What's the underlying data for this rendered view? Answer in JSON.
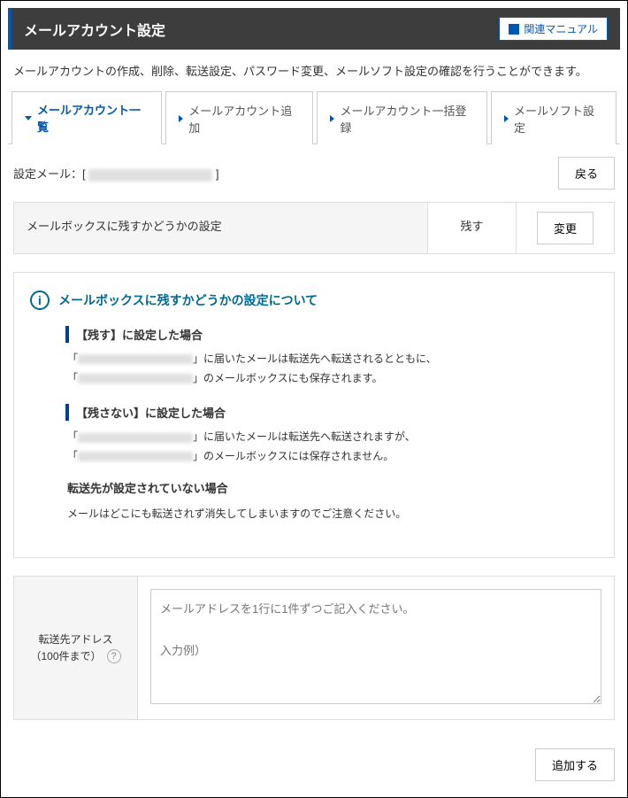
{
  "header": {
    "title": "メールアカウント設定",
    "manual_button": "関連マニュアル"
  },
  "description": "メールアカウントの作成、削除、転送設定、パスワード変更、メールソフト設定の確認を行うことができます。",
  "tabs": [
    {
      "label": "メールアカウント一覧",
      "active": true
    },
    {
      "label": "メールアカウント追加",
      "active": false
    },
    {
      "label": "メールアカウント一括登録",
      "active": false
    },
    {
      "label": "メールソフト設定",
      "active": false
    }
  ],
  "settings_mail": {
    "label": "設定メール：[",
    "label_end": "]",
    "back_button": "戻る"
  },
  "mailbox_setting": {
    "label": "メールボックスに残すかどうかの設定",
    "value": "残す",
    "change_button": "変更"
  },
  "info": {
    "title": "メールボックスに残すかどうかの設定について",
    "keep": {
      "title": "【残す】に設定した場合",
      "line1_prefix": "「",
      "line1_suffix": "」に届いたメールは転送先へ転送されるとともに、",
      "line2_prefix": "「",
      "line2_suffix": "」のメールボックスにも保存されます。"
    },
    "nokeep": {
      "title": "【残さない】に設定した場合",
      "line1_prefix": "「",
      "line1_suffix": "」に届いたメールは転送先へ転送されますが、",
      "line2_prefix": "「",
      "line2_suffix": "」のメールボックスには保存されません。"
    },
    "noforward": {
      "title": "転送先が設定されていない場合",
      "text": "メールはどこにも転送されず消失してしまいますのでご注意ください。"
    }
  },
  "forward": {
    "label_line1": "転送先アドレス",
    "label_line2": "（100件まで）",
    "placeholder": "メールアドレスを1行に1件ずつご記入ください。\n\n入力例）\n\n\n　："
  },
  "footer": {
    "add_button": "追加する"
  }
}
